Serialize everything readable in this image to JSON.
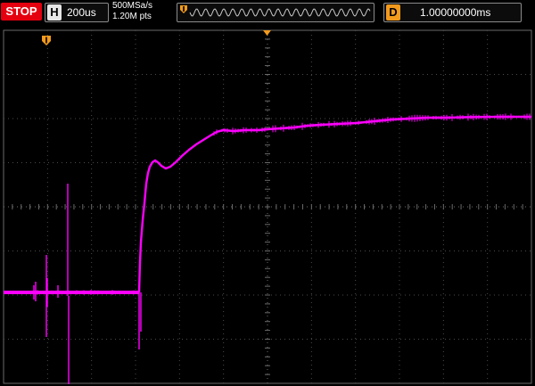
{
  "status": {
    "run_state": "STOP",
    "run_state_color": "#e4000f"
  },
  "timebase": {
    "label": "H",
    "value": "200us"
  },
  "acquisition": {
    "sample_rate": "500MSa/s",
    "memory_depth": "1.20M pts"
  },
  "delay": {
    "label": "D",
    "value": "1.00000000ms"
  },
  "colors": {
    "channel1_trace": "#ff00ff",
    "trigger_marker": "#f29a1d",
    "grid": "#4a4a4a"
  },
  "icons": {
    "trigger_marker": "trigger-position-icon",
    "trigger_level": "trigger-level-icon"
  }
}
